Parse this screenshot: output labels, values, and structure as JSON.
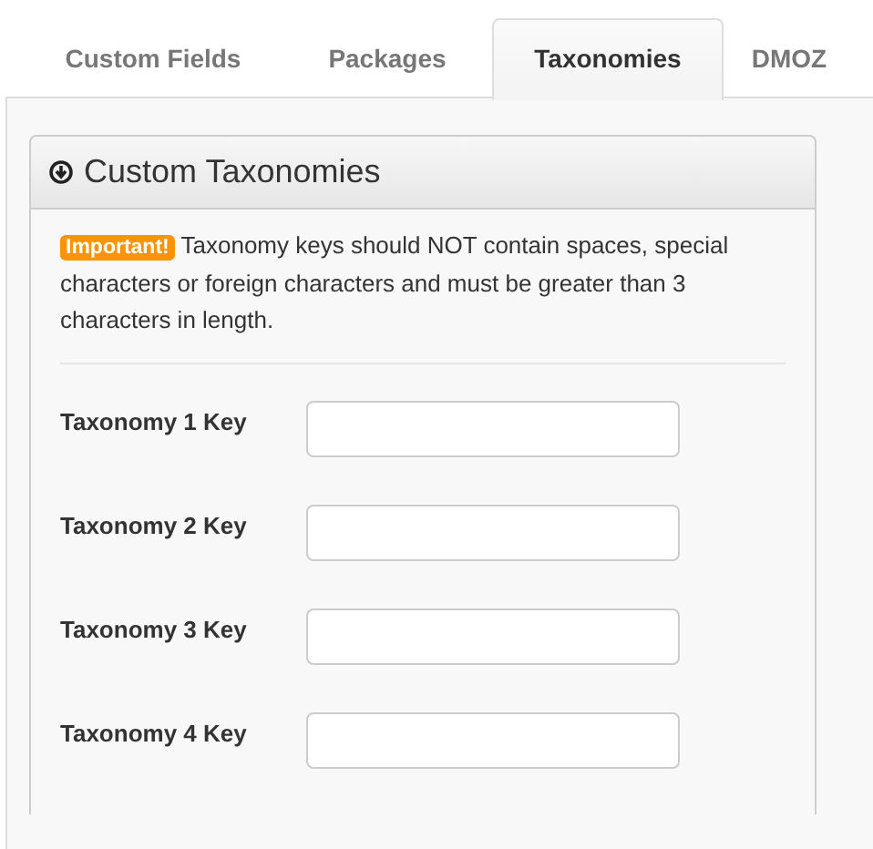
{
  "tabs": [
    {
      "label": "Custom Fields",
      "selected": false
    },
    {
      "label": "Packages",
      "selected": false
    },
    {
      "label": "Taxonomies",
      "selected": true
    },
    {
      "label": "DMOZ",
      "selected": false
    }
  ],
  "panel": {
    "title": "Custom Taxonomies",
    "notice": {
      "badge": "Important!",
      "text": "Taxonomy keys should NOT contain spaces, special characters or foreign characters and must be greater than 3 characters in length."
    },
    "fields": [
      {
        "label": "Taxonomy 1 Key"
      },
      {
        "label": "Taxonomy 2 Key"
      },
      {
        "label": "Taxonomy 3 Key"
      },
      {
        "label": "Taxonomy 4 Key"
      }
    ]
  }
}
